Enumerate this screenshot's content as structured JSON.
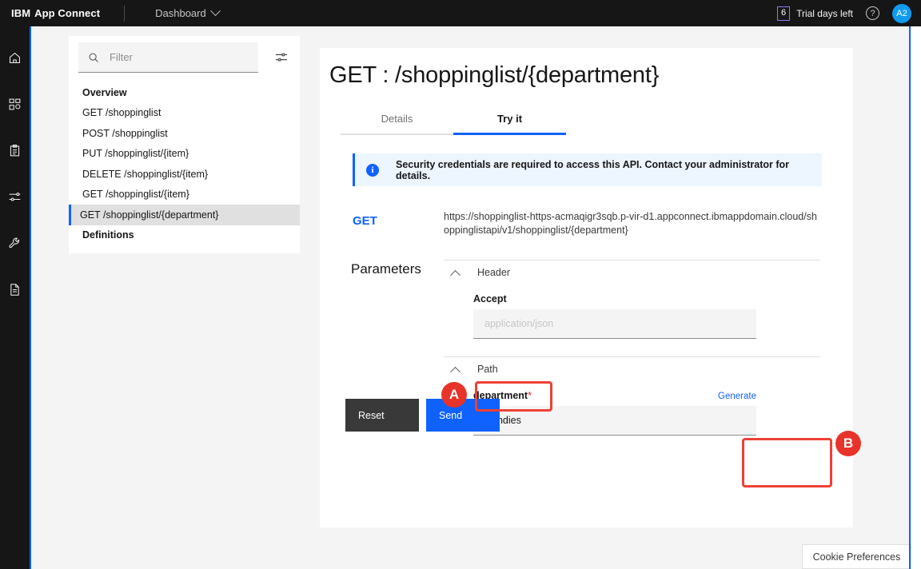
{
  "header": {
    "brand_ibm": "IBM",
    "brand_product": "App Connect",
    "nav_label": "Dashboard",
    "chevron_icon": "chevron-down-icon",
    "trial_count": "6",
    "trial_label": "Trial days left",
    "help_icon": "?",
    "avatar_initials": "A2"
  },
  "rail": {
    "items": [
      {
        "name": "home-icon"
      },
      {
        "name": "apps-icon"
      },
      {
        "name": "clipboard-icon"
      },
      {
        "name": "sliders-icon"
      },
      {
        "name": "wrench-icon"
      },
      {
        "name": "document-icon"
      }
    ]
  },
  "nav_panel": {
    "filter_placeholder": "Filter",
    "filter_value": "",
    "search_icon": "search-icon",
    "settings_icon": "filter-settings-icon",
    "items": [
      {
        "label": "Overview",
        "heading": true,
        "selected": false
      },
      {
        "label": "GET /shoppinglist",
        "heading": false,
        "selected": false
      },
      {
        "label": "POST /shoppinglist",
        "heading": false,
        "selected": false
      },
      {
        "label": "PUT /shoppinglist/{item}",
        "heading": false,
        "selected": false
      },
      {
        "label": "DELETE /shoppinglist/{item}",
        "heading": false,
        "selected": false
      },
      {
        "label": "GET /shoppinglist/{item}",
        "heading": false,
        "selected": false
      },
      {
        "label": "GET /shoppinglist/{department}",
        "heading": false,
        "selected": true
      },
      {
        "label": "Definitions",
        "heading": true,
        "selected": false
      }
    ]
  },
  "main": {
    "title": "GET : /shoppinglist/{department}",
    "tabs": [
      {
        "label": "Details",
        "active": false
      },
      {
        "label": "Try it",
        "active": true
      }
    ],
    "banner": {
      "icon": "info-icon",
      "text": "Security credentials are required to access this API. Contact your administrator for details."
    },
    "request": {
      "method": "GET",
      "url": "https://shoppinglist-https-acmaqigr3sqb.p-vir-d1.appconnect.ibmappdomain.cloud/shoppinglistapi/v1/shoppinglist/{department}"
    },
    "parameters_label": "Parameters",
    "sections": [
      {
        "title": "Header",
        "collapse_icon": "chevron-up-icon",
        "fields": [
          {
            "label": "Accept",
            "required": false,
            "value": "",
            "placeholder": "application/json",
            "generate_label": ""
          }
        ]
      },
      {
        "title": "Path",
        "collapse_icon": "chevron-up-icon",
        "fields": [
          {
            "label": "department",
            "required": true,
            "required_marker": "*",
            "value": "Candies",
            "placeholder": "",
            "generate_label": "Generate"
          }
        ]
      }
    ],
    "buttons": {
      "reset_label": "Reset",
      "send_label": "Send"
    }
  },
  "annotations": [
    {
      "badge": "A",
      "target": "department-input"
    },
    {
      "badge": "B",
      "target": "send-button"
    }
  ],
  "footer": {
    "cookie_label": "Cookie Preferences"
  },
  "colors": {
    "header_bg": "#161616",
    "accent_blue": "#0f62fe",
    "page_bg": "#f4f4f4",
    "annotation_red": "#e8332a",
    "reset_bg": "#393939",
    "required_red": "#da1e28",
    "avatar_bg": "#0f9bf0",
    "banner_bg": "#edf5ff"
  }
}
